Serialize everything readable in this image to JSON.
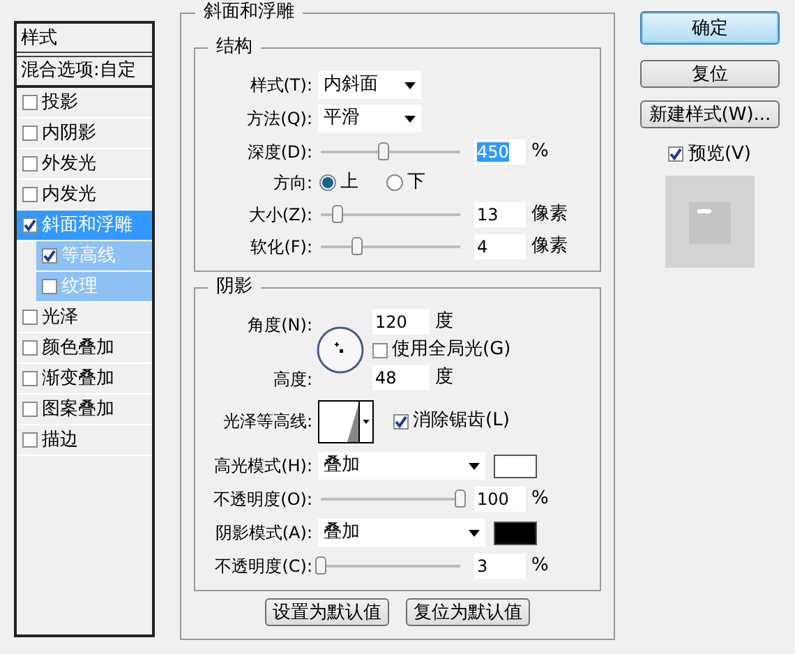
{
  "sidebar": {
    "heading": "样式",
    "blend_options": "混合选项:自定",
    "items": [
      {
        "label": "投影",
        "checked": false,
        "selected": false
      },
      {
        "label": "内阴影",
        "checked": false,
        "selected": false
      },
      {
        "label": "外发光",
        "checked": false,
        "selected": false
      },
      {
        "label": "内发光",
        "checked": false,
        "selected": false
      },
      {
        "label": "斜面和浮雕",
        "checked": true,
        "selected": true,
        "children": [
          {
            "label": "等高线",
            "checked": true,
            "selected": false
          },
          {
            "label": "纹理",
            "checked": false,
            "selected": false
          }
        ]
      },
      {
        "label": "光泽",
        "checked": false,
        "selected": false
      },
      {
        "label": "颜色叠加",
        "checked": false,
        "selected": false
      },
      {
        "label": "渐变叠加",
        "checked": false,
        "selected": false
      },
      {
        "label": "图案叠加",
        "checked": false,
        "selected": false
      },
      {
        "label": "描边",
        "checked": false,
        "selected": false
      }
    ]
  },
  "panel": {
    "title": "斜面和浮雕",
    "structure": {
      "title": "结构",
      "rows": [
        {
          "kind": "select",
          "label": "样式(T):",
          "value": "内斜面"
        },
        {
          "kind": "select",
          "label": "方法(Q):",
          "value": "平滑"
        },
        {
          "kind": "slider",
          "label": "深度(D):",
          "level": 0.45,
          "value": "450",
          "selected": true,
          "unit": "%"
        },
        {
          "kind": "radio",
          "label": "方向:",
          "options": [
            {
              "label": "上",
              "selected": true
            },
            {
              "label": "下",
              "selected": false
            }
          ]
        },
        {
          "kind": "slider",
          "label": "大小(Z):",
          "level": 0.12,
          "value": "13",
          "selected": false,
          "unit": "像素"
        },
        {
          "kind": "slider",
          "label": "软化(F):",
          "level": 0.26,
          "value": "4",
          "selected": false,
          "unit": "像素"
        }
      ]
    },
    "shading": {
      "title": "阴影",
      "angle": {
        "label": "角度(N):",
        "value": "120",
        "unit": "度"
      },
      "global_light": {
        "label": "使用全局光(G)",
        "checked": false
      },
      "altitude": {
        "label": "高度:",
        "value": "48",
        "unit": "度"
      },
      "gloss_contour": {
        "label": "光泽等高线:"
      },
      "anti_alias": {
        "label": "消除锯齿(L)",
        "checked": true
      },
      "rows": [
        {
          "kind": "mode",
          "label": "高光模式(H):",
          "value": "叠加",
          "color": "#ffffff"
        },
        {
          "kind": "slider",
          "label": "不透明度(O):",
          "level": 1,
          "value": "100",
          "selected": false,
          "unit": "%"
        },
        {
          "kind": "mode",
          "label": "阴影模式(A):",
          "value": "叠加",
          "color": "#000000"
        },
        {
          "kind": "slider",
          "label": "不透明度(C):",
          "level": 0,
          "value": "3",
          "selected": false,
          "unit": "%"
        }
      ]
    },
    "buttons": [
      "设置为默认值",
      "复位为默认值"
    ]
  },
  "actions": {
    "buttons": [
      {
        "label": "确定",
        "default": true
      },
      {
        "label": "复位",
        "default": false
      },
      {
        "label": "新建样式(W)...",
        "default": false
      }
    ],
    "preview": {
      "label": "预览(V)",
      "checked": true
    }
  }
}
